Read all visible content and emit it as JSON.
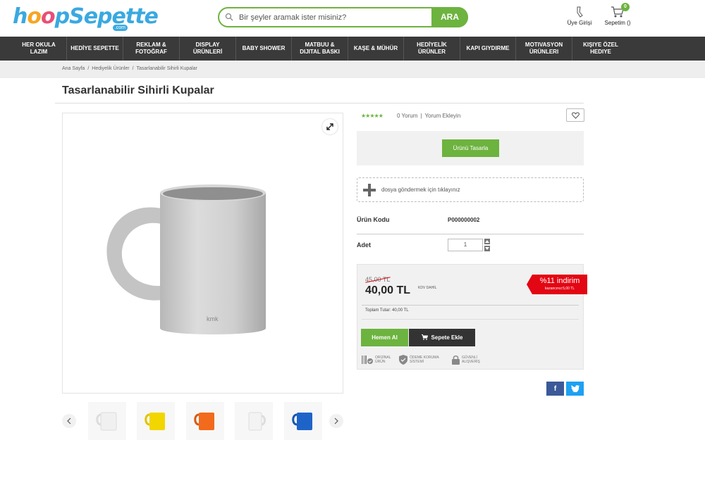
{
  "brand": {
    "logo_text": "hoopSepette",
    "logo_suffix": ".com"
  },
  "search": {
    "placeholder": "Bir şeyler aramak ister misiniz?",
    "button_label": "ARA"
  },
  "header": {
    "user_label": "Üye Girişi",
    "cart_label": "Sepetim ()",
    "cart_count": "0"
  },
  "nav": {
    "items": [
      {
        "label": "HER OKULA LAZIM"
      },
      {
        "label": "HEDİYE SEPETTE"
      },
      {
        "label": "REKLAM & FOTOĞRAF"
      },
      {
        "label": "DISPLAY ÜRÜNLERİ"
      },
      {
        "label": "BABY SHOWER"
      },
      {
        "label": "MATBUU & DIJITAL BASKI"
      },
      {
        "label": "KAŞE & MÜHÜR"
      },
      {
        "label": "HEDİYELİK ÜRÜNLER"
      },
      {
        "label": "KAPI GIYDIRME"
      },
      {
        "label": "MOTIVASYON ÜRÜNLERI"
      },
      {
        "label": "KIŞIYE ÖZEL HEDIYE"
      }
    ]
  },
  "breadcrumb": {
    "items": [
      "Ana Sayfa",
      "Hediyelik Ürünler",
      "Tasarlanabilir Sihirli Kupalar"
    ]
  },
  "product": {
    "title": "Tasarlanabilir Sihirli Kupalar",
    "stars": "★★★★★",
    "reviews_count": "0 Yorum",
    "add_review": "Yorum Ekleyin",
    "design_button": "Ürünü Tasarla",
    "upload_text": "dosya göndermek için tıklayınız",
    "code_label": "Ürün Kodu",
    "code_value": "P000000002",
    "qty_label": "Adet",
    "qty_value": "1",
    "mug_brand": "kmk",
    "old_price": "45,00 TL",
    "new_price": "40,00 TL",
    "kdv_text": "KDV DAHİL",
    "discount_text": "%11 indirim",
    "discount_saving": "kazancınız:5,00 TL",
    "total_text": "Toplam Tutar: 40,00 TL",
    "buy_now": "Hemen Al",
    "add_to_cart": "Sepete Ekle",
    "trust": [
      {
        "text": "ORİJİNAL ÜRÜN",
        "icon": "barcode-icon"
      },
      {
        "text": "ÖDEME KORUMA SİSTEMİ",
        "icon": "shield-icon"
      },
      {
        "text": "GÜVENLİ ALIŞVERİŞ",
        "icon": "lock-icon"
      }
    ],
    "thumbnail_colors": [
      "#ffffff",
      "#f2d600",
      "#f26a1b",
      "#ffffff",
      "#1e64c8"
    ]
  },
  "share": {
    "facebook_label": "f"
  },
  "colors": {
    "accent": "#6db33f",
    "nav_bg": "#3a3a3a",
    "discount": "#e30613"
  }
}
